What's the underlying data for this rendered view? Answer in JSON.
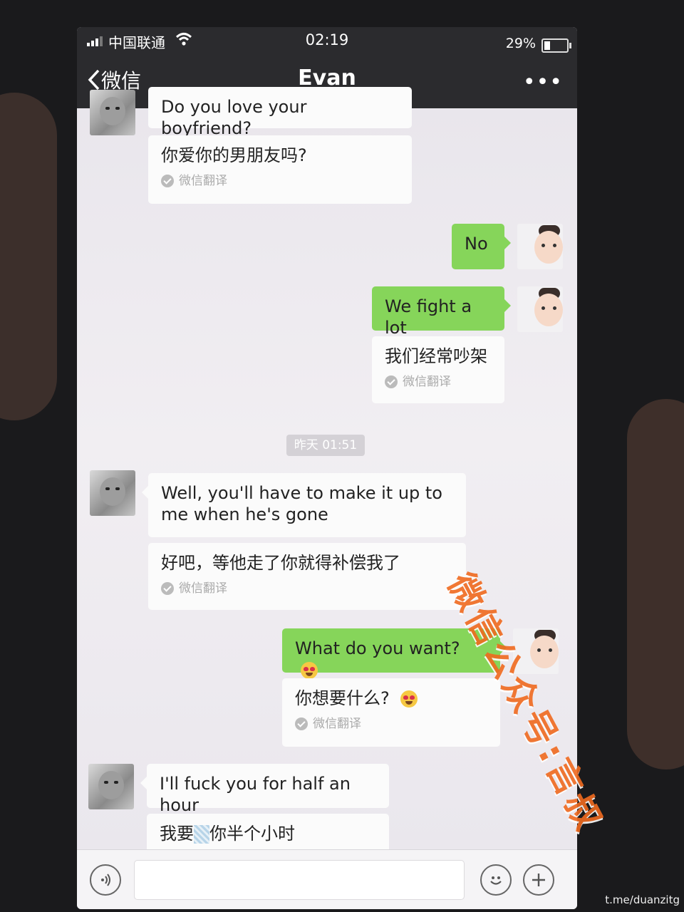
{
  "status_bar": {
    "carrier": "中国联通",
    "time": "02:19",
    "battery": "29%"
  },
  "nav": {
    "back_label": "微信",
    "title": "Evan",
    "more": "•••"
  },
  "messages": [
    {
      "side": "left",
      "text": "Do you love your boyfriend?",
      "translation": "你爱你的男朋友吗?",
      "badge": "微信翻译"
    },
    {
      "side": "right",
      "text": "No"
    },
    {
      "side": "right",
      "text": "We fight a lot",
      "translation": "我们经常吵架",
      "badge": "微信翻译"
    },
    {
      "type": "timestamp",
      "text": "昨天 01:51"
    },
    {
      "side": "left",
      "text": "Well, you'll have to make it up to me when he's gone",
      "translation": "好吧，等他走了你就得补偿我了",
      "badge": "微信翻译"
    },
    {
      "side": "right",
      "text": "What do you want?",
      "translation": "你想要什么?",
      "badge": "微信翻译"
    },
    {
      "side": "left",
      "text": "I'll fuck you for half an hour",
      "translation_pre": "我要",
      "translation_post": "你半个小时"
    }
  ],
  "watermark": "微信公众号:言叔",
  "credit": "t.me/duanzitg"
}
